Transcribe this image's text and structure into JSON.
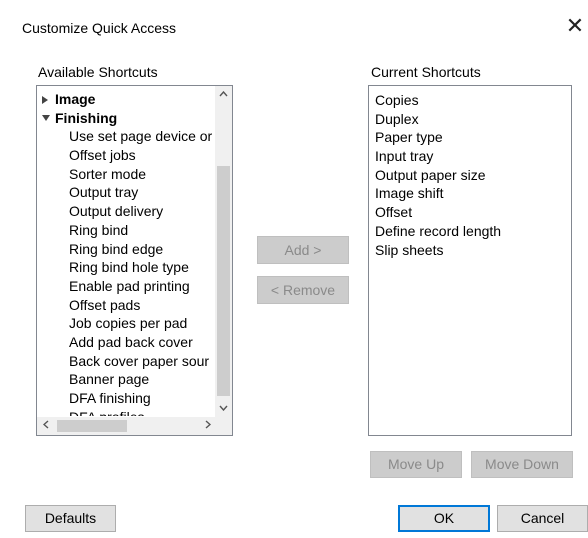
{
  "dialog": {
    "title": "Customize Quick Access",
    "close_glyph": "✕"
  },
  "available": {
    "label": "Available Shortcuts",
    "groups": [
      {
        "label": "Image",
        "expanded": false
      },
      {
        "label": "Finishing",
        "expanded": true
      }
    ],
    "items": [
      "Use set page device or",
      "Offset jobs",
      "Sorter mode",
      "Output tray",
      "Output delivery",
      "Ring bind",
      "Ring bind edge",
      "Ring bind hole type",
      "Enable pad printing",
      "Offset pads",
      "Job copies per pad",
      "Add pad back cover",
      "Back cover paper sour",
      "Banner page",
      "DFA finishing",
      "DFA profiles"
    ]
  },
  "current": {
    "label": "Current Shortcuts",
    "items": [
      "Copies",
      "Duplex",
      "Paper type",
      "Input tray",
      "Output paper size",
      "Image shift",
      "Offset",
      "Define record length",
      "Slip sheets"
    ]
  },
  "buttons": {
    "add": "Add >",
    "remove": "< Remove",
    "move_up": "Move Up",
    "move_down": "Move Down",
    "defaults": "Defaults",
    "ok": "OK",
    "cancel": "Cancel"
  },
  "icons": {
    "scroll_up": "chevron-up-icon",
    "scroll_down": "chevron-down-icon",
    "scroll_left": "chevron-left-icon",
    "scroll_right": "chevron-right-icon",
    "collapsed": "triangle-right-icon",
    "expanded": "triangle-down-icon"
  },
  "colors": {
    "focus_border": "#0078d7",
    "disabled_text": "#8a8a8a"
  }
}
